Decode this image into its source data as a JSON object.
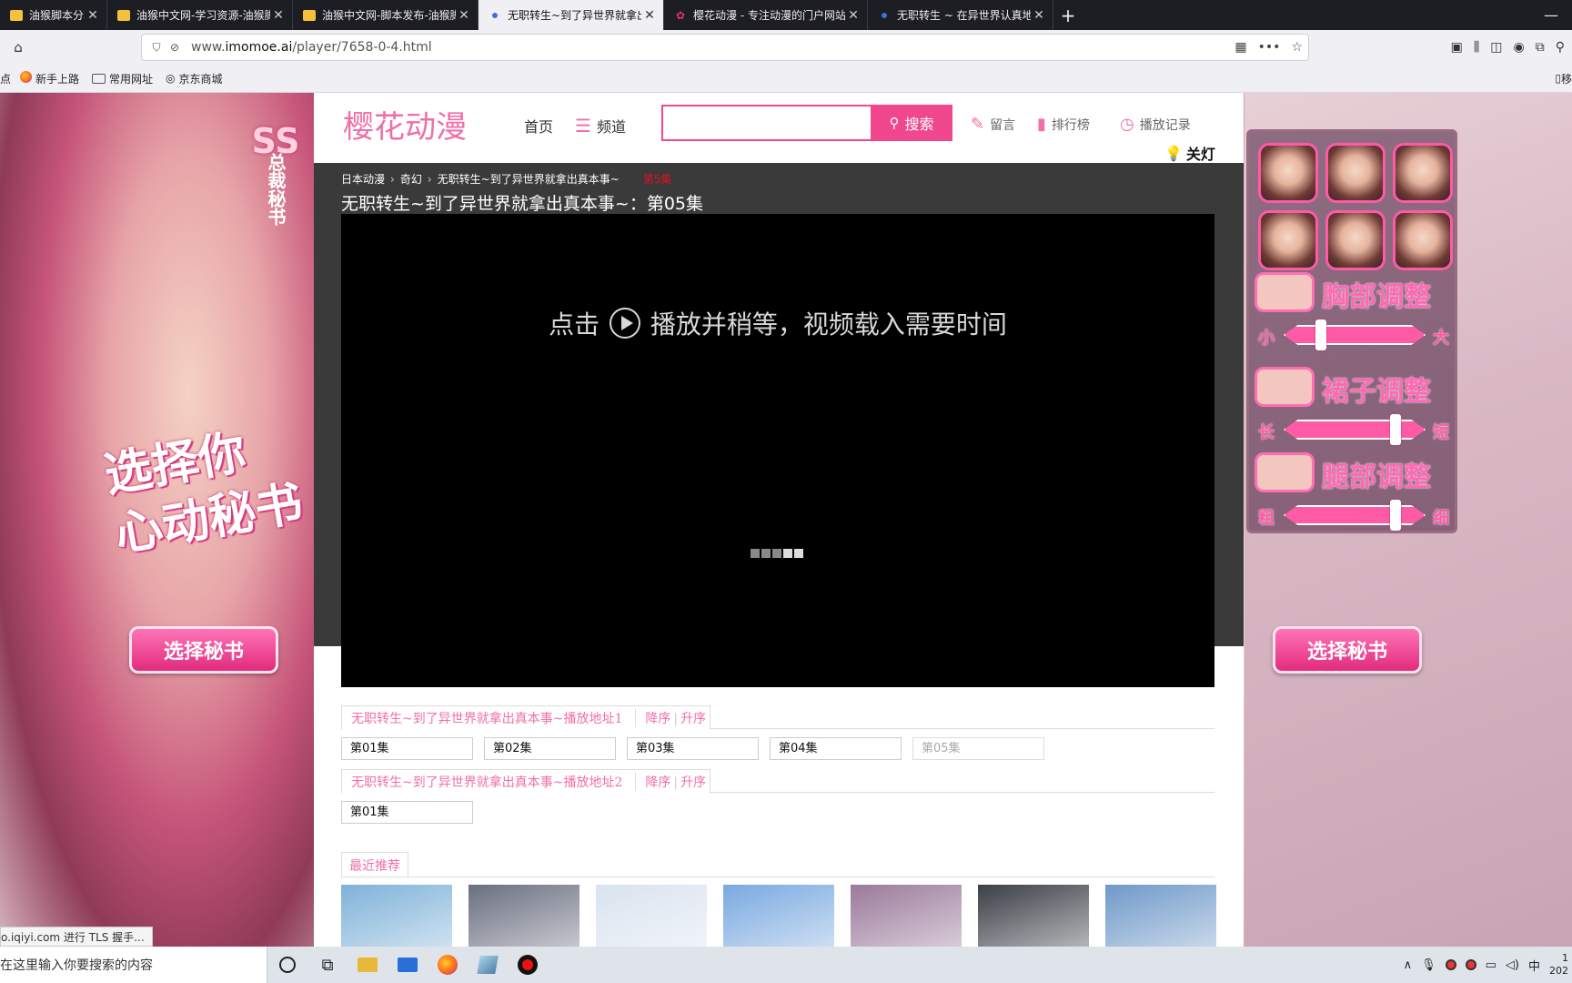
{
  "browser": {
    "tabs": [
      {
        "title": "油猴脚本分享交流",
        "icon": "yellow-favicon",
        "active": false,
        "width": 118
      },
      {
        "title": "油猴中文网-学习资源-油猴脚本",
        "icon": "yellow-favicon",
        "active": false,
        "width": 204
      },
      {
        "title": "油猴中文网-脚本发布-油猴脚本",
        "icon": "yellow-favicon",
        "active": false,
        "width": 204
      },
      {
        "title": "无职转生~到了异世界就拿出真",
        "icon": "dot-favicon",
        "active": true,
        "width": 204
      },
      {
        "title": "樱花动漫 - 专注动漫的门户网站",
        "icon": "flower-favicon",
        "active": false,
        "width": 224
      },
      {
        "title": "无职转生 ~ 在异世界认真地活下去",
        "icon": "dot-favicon",
        "active": false,
        "width": 204
      }
    ],
    "new_tab": "+",
    "minimize": "—",
    "url_prefix": "www.",
    "url_domain": "imomoe.ai",
    "url_path": "/player/7658-0-4.html",
    "bookmarks": [
      {
        "label": "点",
        "icon": ""
      },
      {
        "label": "新手上路",
        "icon": "firefox-icon"
      },
      {
        "label": "常用网址",
        "icon": "folder-icon"
      },
      {
        "label": "京东商城",
        "icon": "globe-icon"
      }
    ],
    "bookmark_right": "移"
  },
  "ad_left": {
    "badge_ss": "SS",
    "badge_text": "总裁秘书",
    "slogan_line1": "选择你",
    "slogan_line2": "心动秘书",
    "button": "选择秘书"
  },
  "ad_right": {
    "adjusters": [
      {
        "title": "胸部调整",
        "low": "小",
        "high": "大",
        "level": 0.2
      },
      {
        "title": "裙子调整",
        "low": "长",
        "high": "短",
        "level": 0.8
      },
      {
        "title": "腿部调整",
        "low": "粗",
        "high": "细",
        "level": 0.8
      }
    ],
    "button": "选择秘书"
  },
  "site": {
    "logo": "樱花动漫",
    "nav": {
      "home": "首页",
      "channel": "频道"
    },
    "search_placeholder": "",
    "search_button": "搜索",
    "links": {
      "message": "留言",
      "ranking": "排行榜",
      "history": "播放记录"
    },
    "light_off": "关灯",
    "breadcrumb": [
      "日本动漫",
      "奇幻",
      "无职转生~到了异世界就拿出真本事~"
    ],
    "breadcrumb_current": "第5集",
    "episode_title": "无职转生~到了异世界就拿出真本事~：第05集",
    "player_hint_before": "点击",
    "player_hint_after": "播放并稍等，视频载入需要时间"
  },
  "sources": [
    {
      "name": "无职转生~到了异世界就拿出真本事~播放地址1",
      "sort_desc": "降序",
      "sort_asc": "升序",
      "episodes": [
        "第01集",
        "第02集",
        "第03集",
        "第04集",
        "第05集"
      ],
      "current": 4
    },
    {
      "name": "无职转生~到了异世界就拿出真本事~播放地址2",
      "sort_desc": "降序",
      "sort_asc": "升序",
      "episodes": [
        "第01集"
      ],
      "current": -1
    }
  ],
  "recommend": {
    "title": "最近推荐",
    "thumbs": [
      "#7fb2d9",
      "#6a6f80",
      "#d9e3ef",
      "#7aa9e0",
      "#9a7a9a",
      "#3a3f46",
      "#6f99c9"
    ]
  },
  "status_link": "o.iqiyi.com 进行 TLS 握手...",
  "taskbar": {
    "search_placeholder": "在这里输入你要搜索的内容",
    "ime": "中",
    "clock_time": "1",
    "clock_date": "202"
  }
}
